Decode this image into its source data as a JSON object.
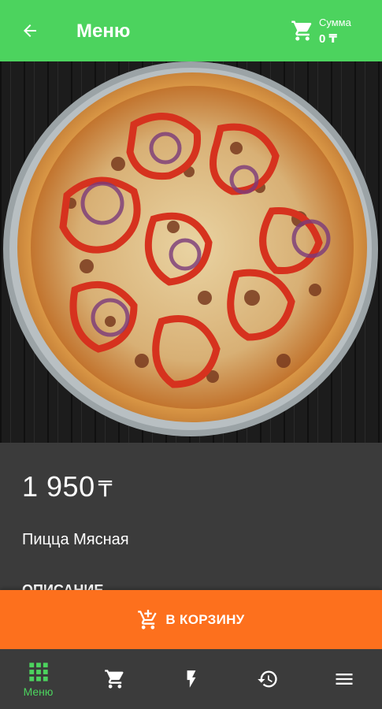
{
  "header": {
    "title": "Меню",
    "sum_label": "Сумма",
    "sum_value": "0 ₸"
  },
  "product": {
    "price": "1 950",
    "currency": "₸",
    "name": "Пицца Мясная",
    "description_title": "ОПИСАНИЕ"
  },
  "actions": {
    "add_to_cart": "В КОРЗИНУ"
  },
  "bottom_nav": {
    "items": [
      {
        "label": "Меню",
        "icon": "grid-icon",
        "active": true
      },
      {
        "label": "",
        "icon": "cart-icon",
        "active": false
      },
      {
        "label": "",
        "icon": "lightning-icon",
        "active": false
      },
      {
        "label": "",
        "icon": "history-icon",
        "active": false
      },
      {
        "label": "",
        "icon": "menu-icon",
        "active": false
      }
    ]
  },
  "colors": {
    "accent_green": "#4cd35e",
    "accent_orange": "#fd701d",
    "background": "#3b3b3b"
  }
}
